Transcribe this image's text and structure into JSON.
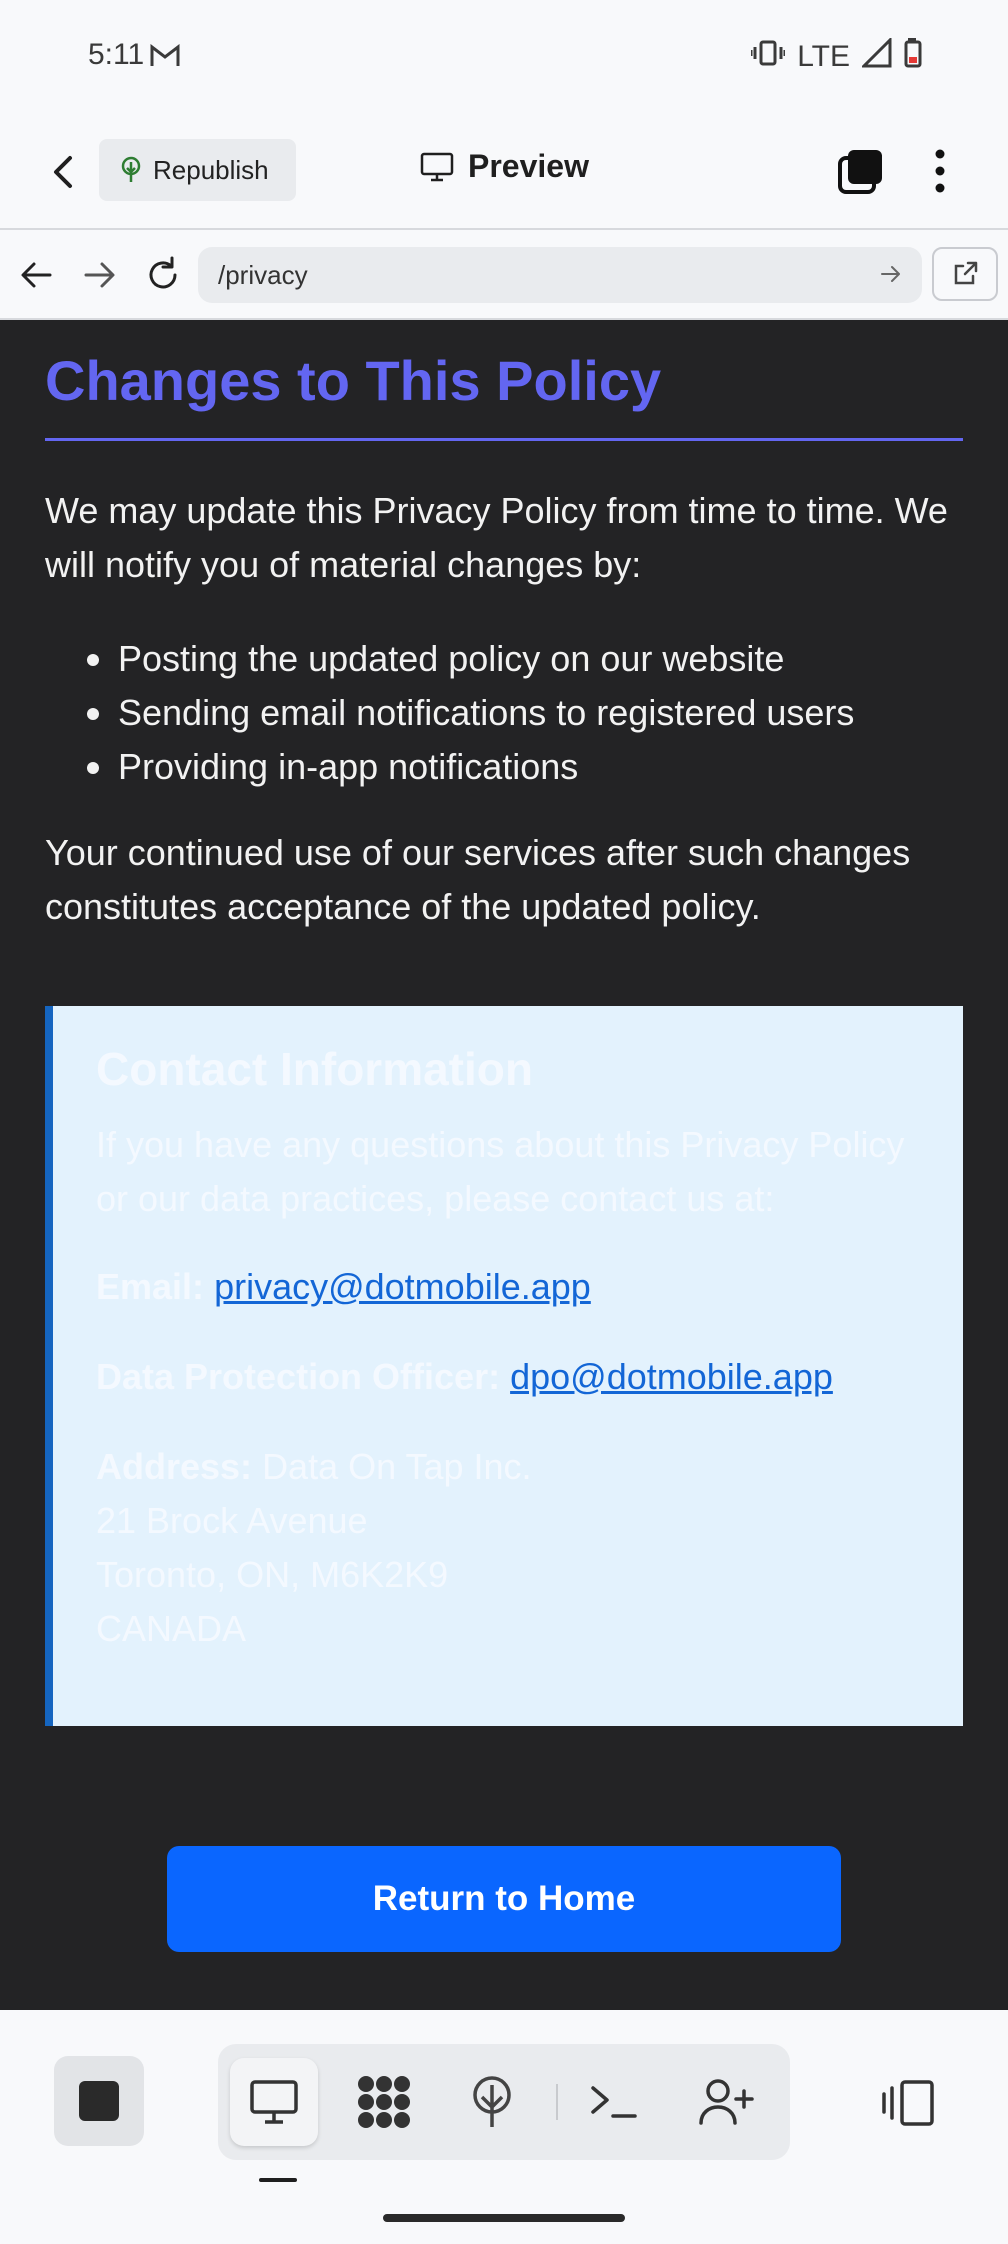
{
  "status_bar": {
    "time": "5:11",
    "network": "LTE"
  },
  "header": {
    "republish_label": "Republish",
    "preview_label": "Preview"
  },
  "browser": {
    "url": "/privacy"
  },
  "policy": {
    "title": "Changes to This Policy",
    "intro": "We may update this Privacy Policy from time to time. We will notify you of material changes by:",
    "bullets": [
      "Posting the updated policy on our website",
      "Sending email notifications to registered users",
      "Providing in-app notifications"
    ],
    "closing": "Your continued use of our services after such changes constitutes acceptance of the updated policy."
  },
  "contact": {
    "title": "Contact Information",
    "intro": "If you have any questions about this Privacy Policy or our data practices, please contact us at:",
    "email_label": "Email:",
    "email": "privacy@dotmobile.app",
    "dpo_label": "Data Protection Officer:",
    "dpo_email": "dpo@dotmobile.app",
    "address_label": "Address:",
    "address_lines": [
      "Data On Tap Inc.",
      "21 Brock Avenue",
      "Toronto, ON, M6K2K9",
      "CANADA"
    ]
  },
  "home_button_label": "Return to Home",
  "colors": {
    "accent": "#6366f1",
    "primary_button": "#0a66ff",
    "contact_bg": "#e3f2fd",
    "contact_border": "#1565c0",
    "page_bg": "#232325"
  },
  "icons": {
    "status": [
      "mail-icon",
      "vibrate-icon",
      "signal-icon",
      "battery-icon"
    ],
    "header": [
      "back-arrow-icon",
      "tree-icon",
      "monitor-icon",
      "windows-icon",
      "more-vertical-icon"
    ],
    "browser": [
      "arrow-left-icon",
      "arrow-right-icon",
      "refresh-icon",
      "arrow-right-small-icon",
      "external-link-icon"
    ],
    "toolbar": [
      "stop-icon",
      "monitor-icon",
      "grid-blob-icon",
      "tree-icon",
      "terminal-icon",
      "add-user-icon",
      "side-panel-icon"
    ]
  }
}
